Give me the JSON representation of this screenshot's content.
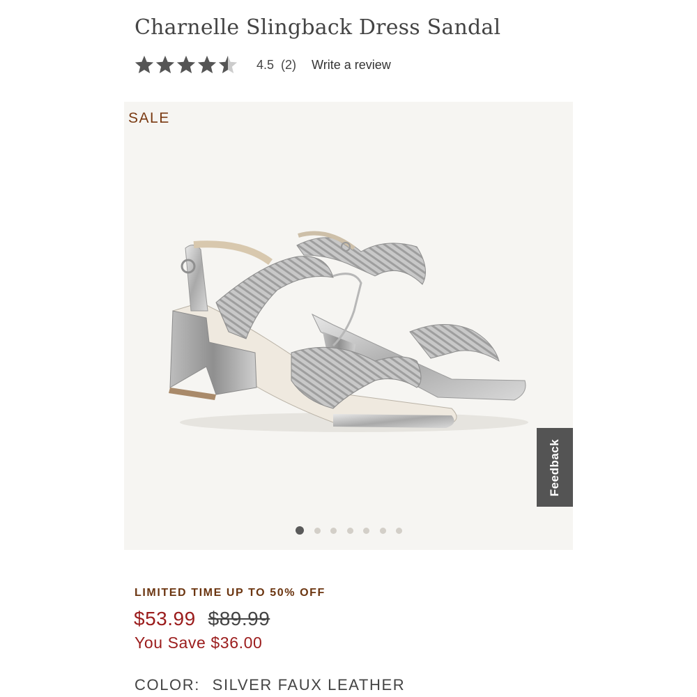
{
  "product": {
    "title": "Charnelle Slingback Dress Sandal",
    "rating": {
      "value": 4.5,
      "value_text": "4.5",
      "count_text": "(2)",
      "write_review_label": "Write a review",
      "star_color": "#555555",
      "empty_star_color": "#cccccc"
    }
  },
  "gallery": {
    "badge": "SALE",
    "feedback_label": "Feedback",
    "slide_count": 7,
    "active_slide": 1,
    "background": "#f6f5f2"
  },
  "pricing": {
    "promo": "LIMITED TIME UP TO 50% OFF",
    "sale_price": "$53.99",
    "original_price": "$89.99",
    "you_save": "You Save $36.00",
    "sale_color": "#9b1c1c",
    "promo_color": "#6b3510"
  },
  "color": {
    "label": "COLOR:",
    "value": "SILVER FAUX LEATHER"
  }
}
